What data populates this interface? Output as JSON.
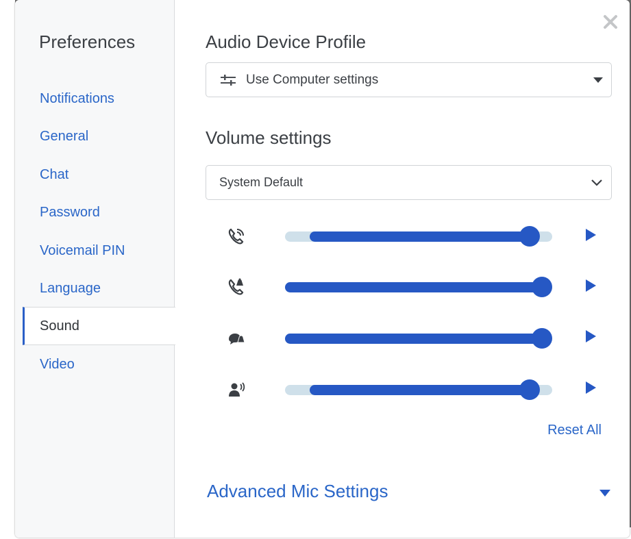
{
  "sidebar": {
    "title": "Preferences",
    "items": [
      {
        "label": "Notifications",
        "active": false
      },
      {
        "label": "General",
        "active": false
      },
      {
        "label": "Chat",
        "active": false
      },
      {
        "label": "Password",
        "active": false
      },
      {
        "label": "Voicemail PIN",
        "active": false
      },
      {
        "label": "Language",
        "active": false
      },
      {
        "label": "Sound",
        "active": true
      },
      {
        "label": "Video",
        "active": false
      }
    ]
  },
  "close_icon": "close-icon",
  "audio_profile": {
    "title": "Audio Device Profile",
    "selected": "Use Computer settings",
    "icon": "sliders-icon"
  },
  "volume": {
    "title": "Volume settings",
    "selected": "System Default",
    "rows": [
      {
        "icon": "phone-ringing-icon",
        "level": 0.95
      },
      {
        "icon": "phone-alert-icon",
        "level": 1.0
      },
      {
        "icon": "chat-bubble-icon",
        "level": 1.0
      },
      {
        "icon": "speaker-person-icon",
        "level": 0.95
      }
    ]
  },
  "reset_label": "Reset All",
  "advanced_label": "Advanced Mic Settings",
  "colors": {
    "accent": "#2658c4",
    "link": "#2a66c8",
    "track": "#cfe0ea"
  }
}
